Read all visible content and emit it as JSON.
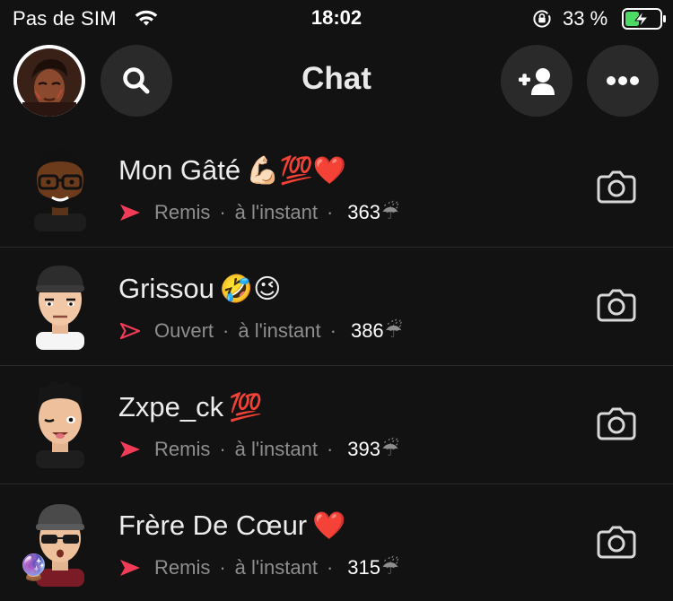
{
  "status_bar": {
    "carrier": "Pas de SIM",
    "time": "18:02",
    "battery_percent": "33 %",
    "battery_level": 0.33
  },
  "header": {
    "title": "Chat"
  },
  "chats": [
    {
      "name": "Mon Gâté",
      "name_emoji": "💪🏻💯❤️",
      "status": "Remis",
      "status_type": "delivered",
      "time": "à l'instant",
      "streak": "363",
      "streak_emoji": "☔"
    },
    {
      "name": "Grissou",
      "name_emoji": "🤣😉",
      "status": "Ouvert",
      "status_type": "opened",
      "time": "à l'instant",
      "streak": "386",
      "streak_emoji": "☔"
    },
    {
      "name": "Zxpe_ck",
      "name_emoji": "💯",
      "status": "Remis",
      "status_type": "delivered",
      "time": "à l'instant",
      "streak": "393",
      "streak_emoji": "☔"
    },
    {
      "name": "Frère De Cœur",
      "name_emoji": "❤️",
      "status": "Remis",
      "status_type": "delivered",
      "time": "à l'instant",
      "streak": "315",
      "streak_emoji": "☔",
      "badge_emoji": "🔮"
    }
  ],
  "colors": {
    "background": "#121212",
    "button_bg": "#2a2a2a",
    "delivered_red": "#f23c57",
    "meta_gray": "#8e8e8e",
    "battery_green": "#4cd964"
  },
  "icons": {
    "search": "search-icon",
    "add_friend": "add-friend-icon",
    "more": "more-icon",
    "camera": "camera-icon"
  }
}
